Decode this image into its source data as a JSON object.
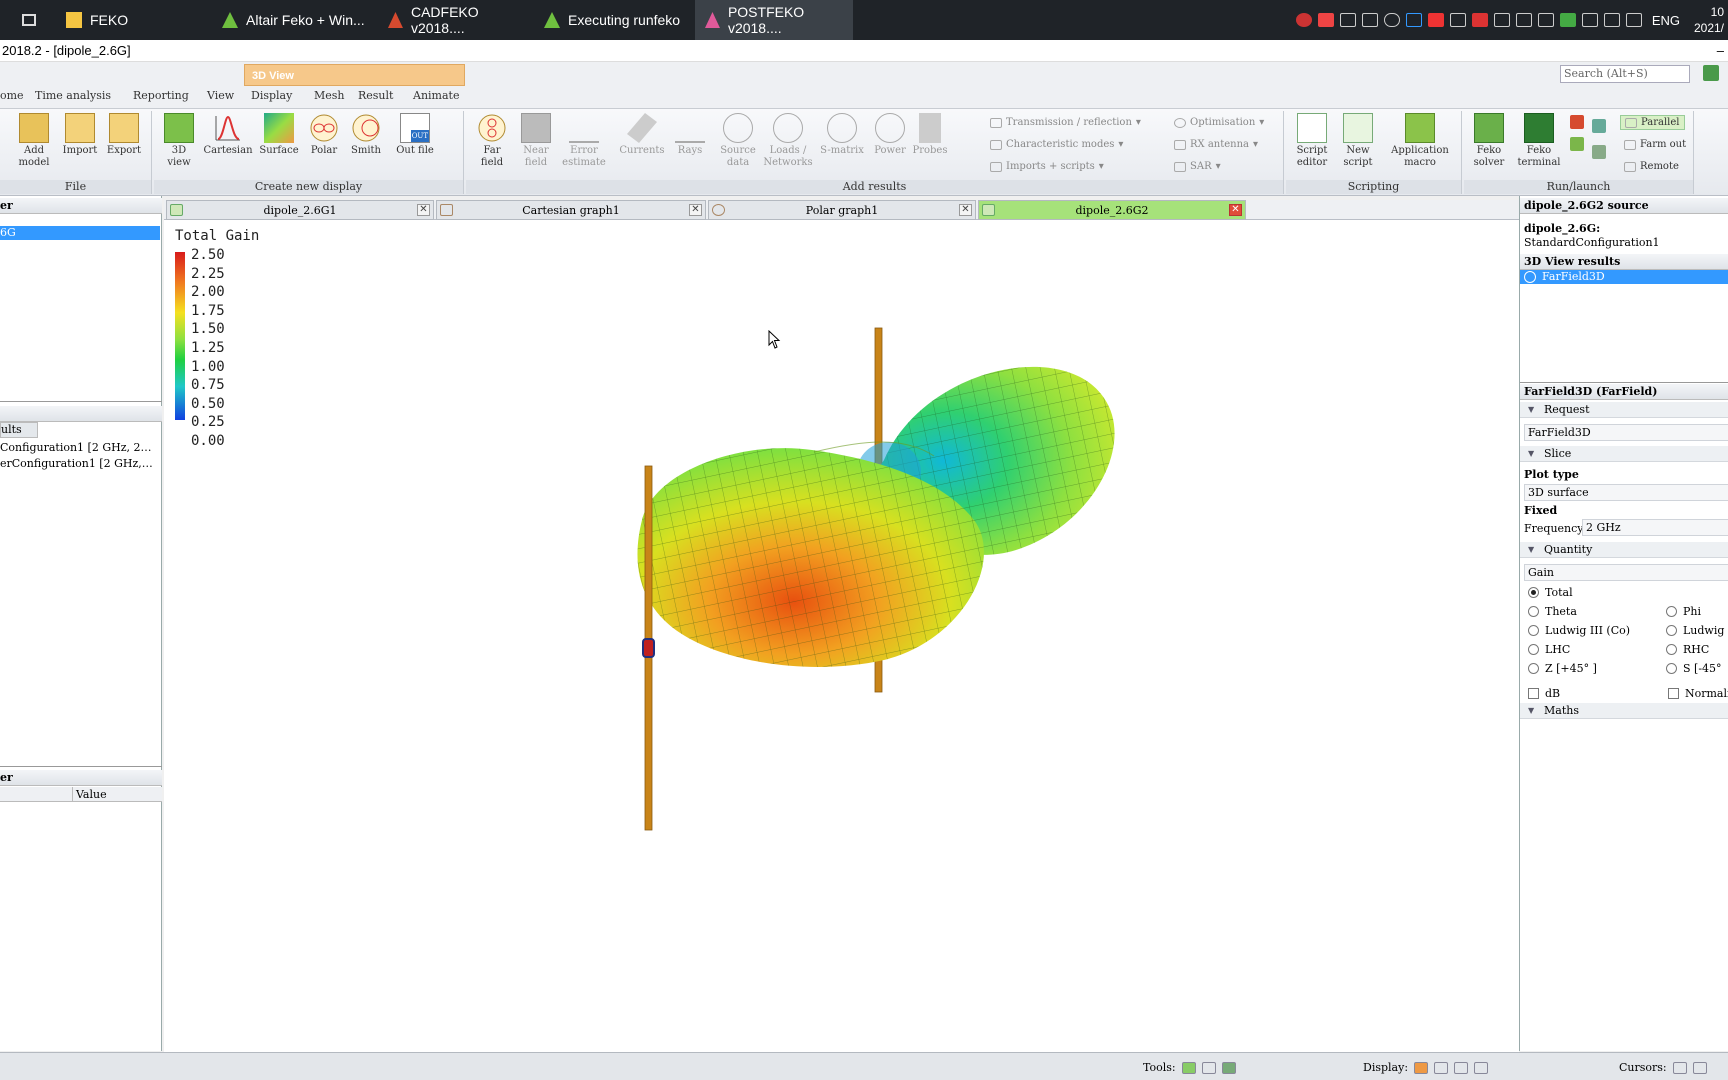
{
  "taskbar": {
    "items": [
      {
        "label": "FEKO"
      },
      {
        "label": "Altair Feko + Win..."
      },
      {
        "label": "CADFEKO v2018...."
      },
      {
        "label": "Executing runfeko"
      },
      {
        "label": "POSTFEKO v2018...."
      }
    ],
    "lang": "ENG",
    "clock_time": "10",
    "clock_date": "2021/"
  },
  "window": {
    "title": "2018.2 - [dipole_2.6G]"
  },
  "ribbon_tabs": {
    "context_tab": "3D View",
    "tabs": [
      "ome",
      "Time analysis",
      "Reporting",
      "View",
      "Display",
      "Mesh",
      "Result",
      "Animate"
    ],
    "search_placeholder": "Search (Alt+S)"
  },
  "ribbon": {
    "file_group": {
      "label": "File",
      "buttons": [
        {
          "label": "Add\nmodel"
        },
        {
          "label": "Import"
        },
        {
          "label": "Export"
        }
      ]
    },
    "create_group": {
      "label": "Create new display",
      "buttons": [
        {
          "label": "3D\nview"
        },
        {
          "label": "Cartesian"
        },
        {
          "label": "Surface"
        },
        {
          "label": "Polar"
        },
        {
          "label": "Smith"
        },
        {
          "label": "Out file"
        }
      ]
    },
    "add_results_group": {
      "label": "Add results",
      "buttons": [
        {
          "label": "Far\nfield"
        },
        {
          "label": "Near\nfield"
        },
        {
          "label": "Error\nestimate"
        },
        {
          "label": "Currents"
        },
        {
          "label": "Rays"
        },
        {
          "label": "Source\ndata"
        },
        {
          "label": "Loads /\nNetworks"
        },
        {
          "label": "S-matrix"
        },
        {
          "label": "Power"
        },
        {
          "label": "Probes"
        }
      ],
      "small": [
        {
          "label": "Transmission / reflection"
        },
        {
          "label": "Characteristic modes"
        },
        {
          "label": "Imports + scripts"
        },
        {
          "label": "Optimisation"
        },
        {
          "label": "RX antenna"
        },
        {
          "label": "SAR"
        }
      ]
    },
    "scripting_group": {
      "label": "Scripting",
      "buttons": [
        {
          "label": "Script\neditor"
        },
        {
          "label": "New\nscript"
        },
        {
          "label": "Application\nmacro"
        }
      ]
    },
    "run_group": {
      "label": "Run/launch",
      "buttons": [
        {
          "label": "Feko\nsolver"
        },
        {
          "label": "Feko\nterminal"
        }
      ],
      "small": [
        {
          "label": "Parallel"
        },
        {
          "label": "Farm out"
        },
        {
          "label": "Remote"
        }
      ]
    }
  },
  "left_panel": {
    "header1": "er",
    "selected_item": "6G",
    "results_tab": "ults",
    "results": [
      "Configuration1 [2 GHz, 2…",
      "erConfiguration1 [2 GHz,…"
    ],
    "header2": "er",
    "value_col": "Value"
  },
  "doc_tabs": [
    {
      "label": "dipole_2.6G1"
    },
    {
      "label": "Cartesian graph1"
    },
    {
      "label": "Polar graph1"
    },
    {
      "label": "dipole_2.6G2"
    }
  ],
  "legend": {
    "title": "Total Gain",
    "ticks": [
      "2.50",
      "2.25",
      "2.00",
      "1.75",
      "1.50",
      "1.25",
      "1.00",
      "0.75",
      "0.50",
      "0.25",
      "0.00"
    ]
  },
  "right_panel": {
    "source_header": "dipole_2.6G2 source",
    "source_name": "dipole_2.6G:",
    "source_config": "StandardConfiguration1",
    "results_header": "3D View results",
    "selected_result": "FarField3D",
    "props_header": "FarField3D (FarField)",
    "request_label": "Request",
    "request_value": "FarField3D",
    "slice_label": "Slice",
    "plot_type_label": "Plot type",
    "plot_type_value": "3D surface",
    "fixed_label": "Fixed",
    "frequency_label": "Frequency",
    "frequency_value": "2 GHz",
    "quantity_label": "Quantity",
    "quantity_value": "Gain",
    "radios": {
      "total": "Total",
      "theta": "Theta",
      "phi": "Phi",
      "ludwig_co": "Ludwig III (Co)",
      "ludwig_cx": "Ludwig I",
      "lhc": "LHC",
      "rhc": "RHC",
      "z45": "Z [+45° ]",
      "s45": "S [-45°"
    },
    "db_label": "dB",
    "normalise_label": "Normali",
    "maths_label": "Maths"
  },
  "statusbar": {
    "tools_label": "Tools:",
    "display_label": "Display:",
    "cursors_label": "Cursors:"
  },
  "colors": {
    "selection": "#3399ff",
    "ribbon_context_tab": "#f6c88a",
    "active_doc_tab": "#a6e27a"
  }
}
